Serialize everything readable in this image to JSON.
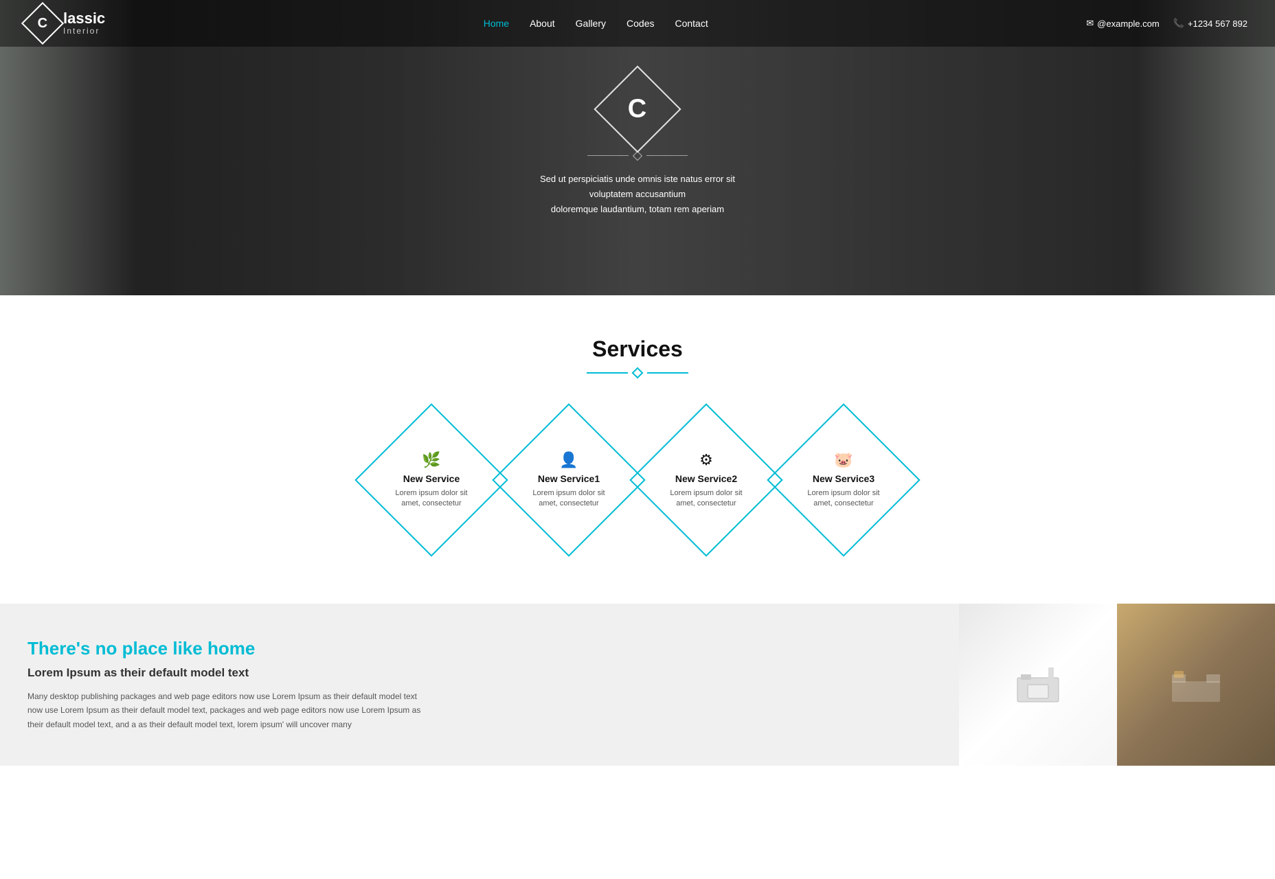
{
  "navbar": {
    "logo_letter": "C",
    "logo_name": "lassic",
    "logo_sub": "Interior",
    "nav_items": [
      {
        "label": "Home",
        "active": true
      },
      {
        "label": "About",
        "active": false
      },
      {
        "label": "Gallery",
        "active": false
      },
      {
        "label": "Codes",
        "active": false
      },
      {
        "label": "Contact",
        "active": false
      }
    ],
    "email_icon": "✉",
    "email": "@example.com",
    "phone_icon": "📞",
    "phone": "+1234 567 892"
  },
  "hero": {
    "logo_letter": "C",
    "tagline1": "Sed ut perspiciatis unde omnis iste natus error sit voluptatem accusantium",
    "tagline2": "doloremque laudantium, totam rem aperiam"
  },
  "services": {
    "section_title": "Services",
    "items": [
      {
        "icon": "🌿",
        "name": "New Service",
        "desc": "Lorem ipsum dolor sit amet, consectetur"
      },
      {
        "icon": "👤",
        "name": "New Service1",
        "desc": "Lorem ipsum dolor sit amet, consectetur"
      },
      {
        "icon": "⚙",
        "name": "New Service2",
        "desc": "Lorem ipsum dolor sit amet, consectetur"
      },
      {
        "icon": "🐷",
        "name": "New Service3",
        "desc": "Lorem ipsum dolor sit amet, consectetur"
      }
    ]
  },
  "bottom": {
    "heading": "There's no place like home",
    "subheading": "Lorem Ipsum as their default model text",
    "body": "Many desktop publishing packages and web page editors now use Lorem Ipsum as their default model text now use Lorem Ipsum as their default model text, packages and web page editors now use Lorem Ipsum as their default model text, and a as their default model text, lorem ipsum' will uncover many"
  }
}
